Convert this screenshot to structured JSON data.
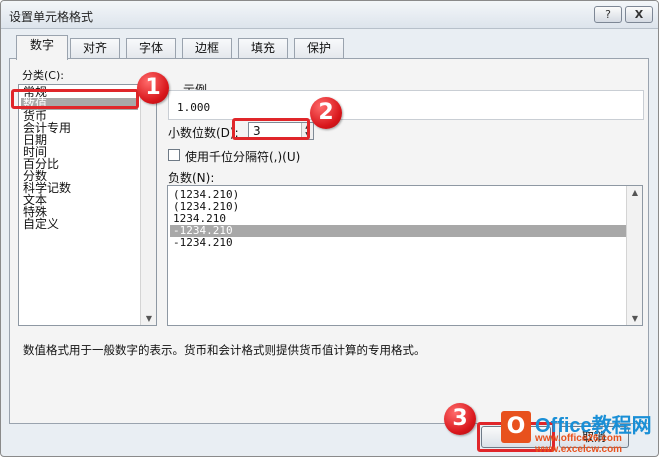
{
  "window": {
    "title": "设置单元格格式",
    "help_label": "?",
    "close_label": "X"
  },
  "tabs": [
    {
      "label": "数字",
      "active": true
    },
    {
      "label": "对齐",
      "active": false
    },
    {
      "label": "字体",
      "active": false
    },
    {
      "label": "边框",
      "active": false
    },
    {
      "label": "填充",
      "active": false
    },
    {
      "label": "保护",
      "active": false
    }
  ],
  "category": {
    "label": "分类(C):",
    "items": [
      "常规",
      "数值",
      "货币",
      "会计专用",
      "日期",
      "时间",
      "百分比",
      "分数",
      "科学记数",
      "文本",
      "特殊",
      "自定义"
    ],
    "selected_index": 1
  },
  "sample": {
    "label": "示例",
    "value": "1.000"
  },
  "decimal": {
    "label": "小数位数(D):",
    "value": "3"
  },
  "thousands": {
    "label": "使用千位分隔符(,)(U)",
    "checked": false
  },
  "negative": {
    "label": "负数(N):",
    "items": [
      "(1234.210)",
      "(1234.210)",
      "1234.210",
      "-1234.210",
      "-1234.210"
    ],
    "selected_index": 3
  },
  "description": "数值格式用于一般数字的表示。货币和会计格式则提供货币值计算的专用格式。",
  "buttons": {
    "ok_label": "确定",
    "cancel_label": "取消"
  },
  "annotations": {
    "markers": [
      "1",
      "2",
      "3"
    ],
    "color": "#e0262a"
  },
  "watermark": {
    "logo": "O",
    "brand": "Office教程网",
    "url1": "www.office26.com",
    "url2": "www.excelcw.com"
  },
  "colors": {
    "selection": "#a8a8a8",
    "dialog_bg": "#e9eef3"
  }
}
